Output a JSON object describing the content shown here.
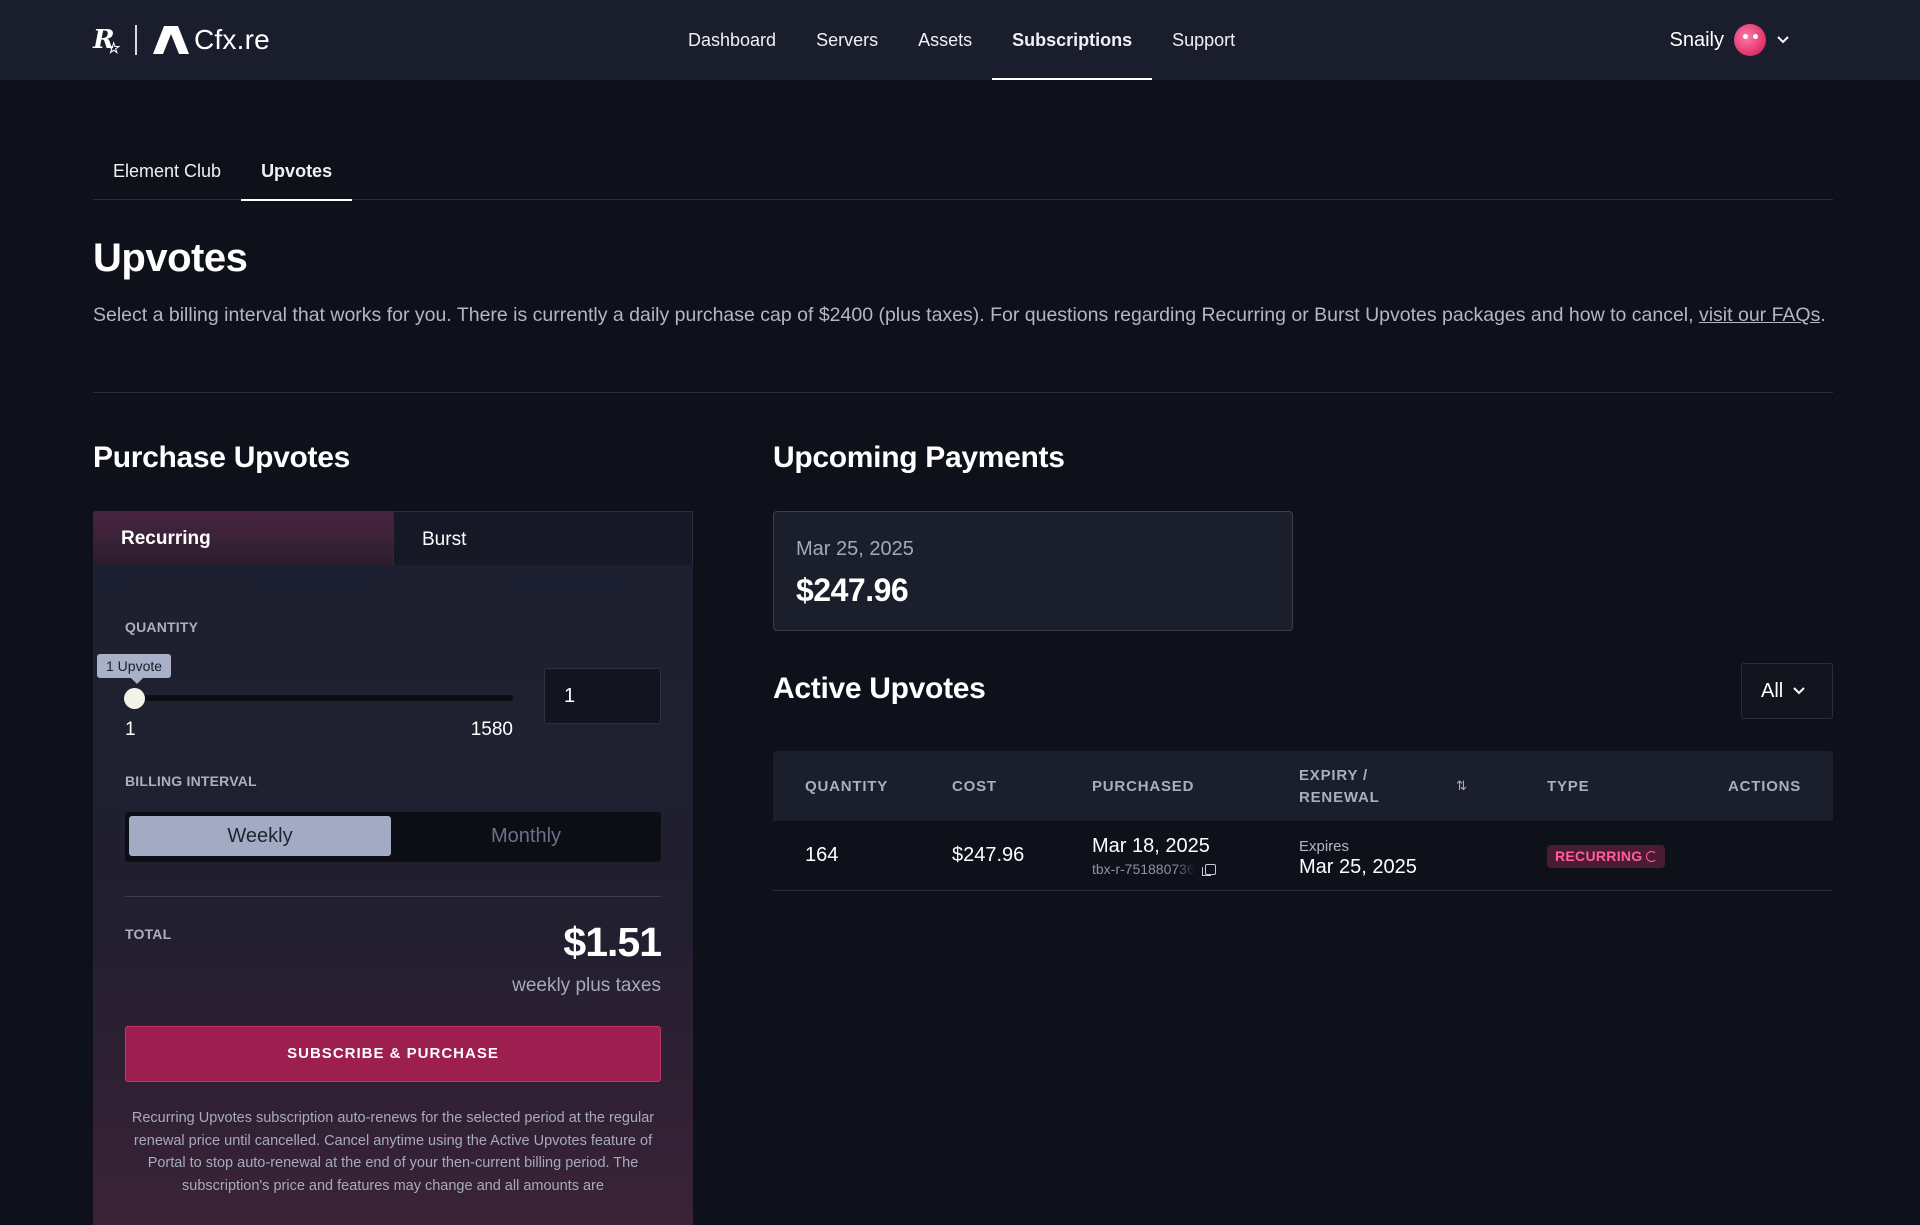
{
  "brand": {
    "rockstar": "R",
    "name": "Cfx.re"
  },
  "nav": {
    "items": [
      {
        "label": "Dashboard"
      },
      {
        "label": "Servers"
      },
      {
        "label": "Assets"
      },
      {
        "label": "Subscriptions"
      },
      {
        "label": "Support"
      }
    ],
    "active": "Subscriptions"
  },
  "user": {
    "name": "Snaily"
  },
  "subtabs": [
    {
      "label": "Element Club"
    },
    {
      "label": "Upvotes"
    }
  ],
  "page": {
    "title": "Upvotes",
    "description": "Select a billing interval that works for you. There is currently a daily purchase cap of $2400 (plus taxes). For questions regarding Recurring or Burst Upvotes packages and how to cancel, ",
    "faq_link": "visit our FAQs",
    "faq_suffix": "."
  },
  "purchase": {
    "title": "Purchase Upvotes",
    "tabs": [
      {
        "label": "Recurring"
      },
      {
        "label": "Burst"
      }
    ],
    "quantity_label": "QUANTITY",
    "tooltip": "1 Upvote",
    "slider": {
      "min": "1",
      "max": "1580",
      "value": 1
    },
    "quantity_value": "1",
    "billing_label": "BILLING INTERVAL",
    "intervals": [
      {
        "label": "Weekly"
      },
      {
        "label": "Monthly"
      }
    ],
    "selected_interval": "Weekly",
    "total_label": "TOTAL",
    "total_price": "$1.51",
    "total_sub": "weekly plus taxes",
    "button": "SUBSCRIBE & PURCHASE",
    "legal": "Recurring Upvotes subscription auto-renews for the selected period at the regular renewal price until cancelled. Cancel anytime using the Active Upvotes feature of Portal to stop auto-renewal at the end of your then-current billing period. The subscription's price and features may change and all amounts are"
  },
  "upcoming": {
    "title": "Upcoming Payments",
    "date": "Mar 25, 2025",
    "amount": "$247.96"
  },
  "active": {
    "title": "Active Upvotes",
    "filter": "All",
    "columns": {
      "quantity": "QUANTITY",
      "cost": "COST",
      "purchased": "PURCHASED",
      "expiry": "EXPIRY /",
      "expiry2": "RENEWAL",
      "type": "TYPE",
      "actions": "ACTIONS"
    },
    "rows": [
      {
        "quantity": "164",
        "cost": "$247.96",
        "purchased": "Mar 18, 2025",
        "txn": "tbx-r-751880736",
        "expiry_label": "Expires",
        "expiry": "Mar 25, 2025",
        "type": "RECURRING"
      }
    ]
  },
  "colors": {
    "background": "#0f111a",
    "nav_bg": "#1a1d2b",
    "accent": "#9c1f4f",
    "badge_text": "#ff5ea0"
  },
  "icons": [
    "rockstar-logo",
    "cfx-logo-icon",
    "avatar",
    "chevron-down-icon",
    "sort-icon",
    "copy-icon",
    "renew-icon"
  ]
}
